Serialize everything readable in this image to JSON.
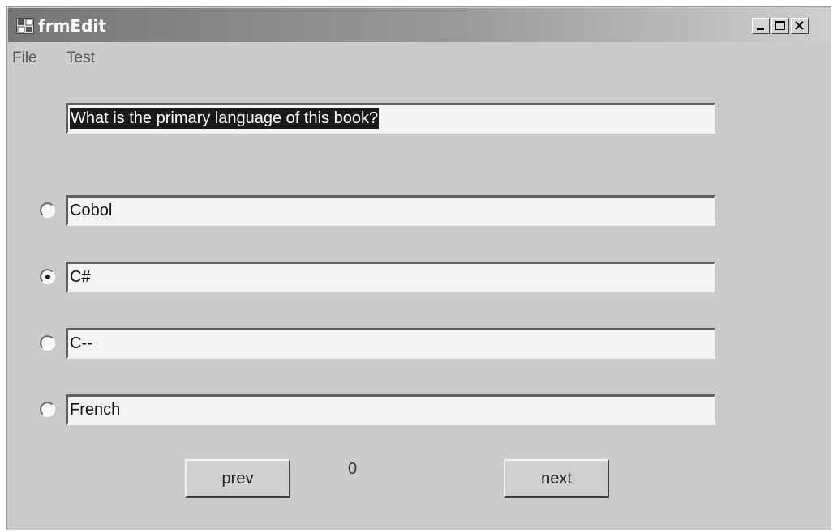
{
  "window": {
    "title": "frmEdit"
  },
  "menu": {
    "items": [
      "File",
      "Test"
    ]
  },
  "question": {
    "value": "What is the primary language of this book?"
  },
  "answers": [
    {
      "value": "Cobol",
      "checked": false
    },
    {
      "value": "C#",
      "checked": true
    },
    {
      "value": "C--",
      "checked": false
    },
    {
      "value": "French",
      "checked": false
    }
  ],
  "nav": {
    "prev_label": "prev",
    "next_label": "next",
    "counter": "0"
  }
}
